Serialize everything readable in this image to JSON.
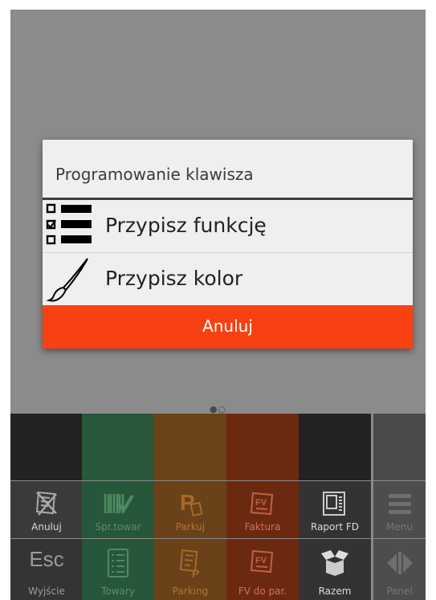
{
  "dialog": {
    "title": "Programowanie klawisza",
    "options": [
      {
        "label": "Przypisz funkcję",
        "icon": "checklist-icon"
      },
      {
        "label": "Przypisz kolor",
        "icon": "paintbrush-icon"
      }
    ],
    "cancel_label": "Anuluj",
    "cancel_color": "#f84112"
  },
  "pager": {
    "dots": "●○"
  },
  "keypad": {
    "row1": [
      {
        "color": "#232323"
      },
      {
        "color": "#285839"
      },
      {
        "color": "#6b4219"
      },
      {
        "color": "#6b2a10"
      },
      {
        "color": "#232323"
      },
      {
        "color": "#4a4a4a"
      }
    ],
    "row2": [
      {
        "label": "Anuluj",
        "icon": "receipt-cancel-icon",
        "color": "#3a3a3a",
        "text_color": "#d8d8d8"
      },
      {
        "label": "Spr.towar",
        "icon": "barcode-check-icon",
        "color": "#27573a",
        "text_color": "#5a8f6a"
      },
      {
        "label": "Parkuj",
        "icon": "parking-icon",
        "color": "#6a4118",
        "text_color": "#b07434"
      },
      {
        "label": "Faktura",
        "icon": "invoice-icon",
        "color": "#6b2a10",
        "text_color": "#d07060"
      },
      {
        "label": "Raport FD",
        "icon": "fiscal-printer-icon",
        "color": "#333333",
        "text_color": "#dddddd"
      },
      {
        "label": "Menu",
        "icon": "hamburger-menu-icon",
        "color": "#4d4d4d",
        "text_color": "#777777"
      }
    ],
    "row3": [
      {
        "label": "Wyjście",
        "top": "Esc",
        "icon": "escape-icon",
        "color": "#343434",
        "text_color": "#9b9b9b"
      },
      {
        "label": "Towary",
        "icon": "product-list-icon",
        "color": "#27573a",
        "text_color": "#5a8f6a"
      },
      {
        "label": "Parking",
        "icon": "parking-receipts-icon",
        "color": "#6a4118",
        "text_color": "#b07434"
      },
      {
        "label": "FV do par.",
        "icon": "invoice-to-receipt-icon",
        "color": "#6b2a10",
        "text_color": "#d07060"
      },
      {
        "label": "Razem",
        "icon": "open-box-icon",
        "color": "#333333",
        "text_color": "#dddddd"
      },
      {
        "label": "Panel",
        "icon": "panel-switch-icon",
        "color": "#4d4d4d",
        "text_color": "#777777"
      }
    ]
  }
}
